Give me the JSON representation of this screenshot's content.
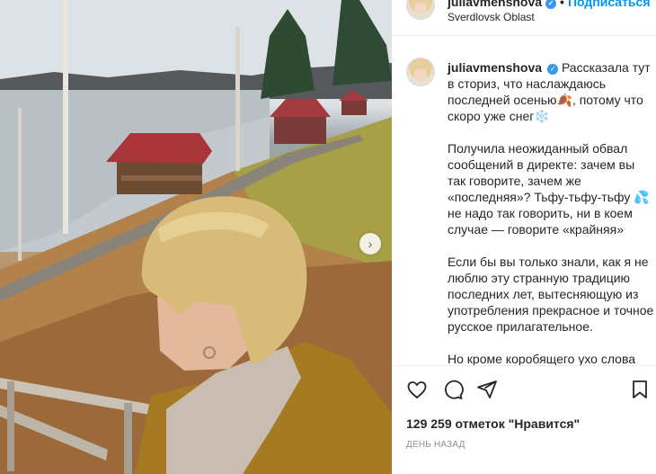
{
  "post": {
    "username": "juliavmenshova",
    "follow_label": "Подписаться",
    "separator": "•",
    "location": "Sverdlovsk Oblast"
  },
  "caption": {
    "username": "juliavmenshova",
    "paragraph_1": "Рассказала тут в сториз, что наслаждаюсь последней осенью🍂, потому что скоро уже снег❄️",
    "paragraph_2": "Получила неожиданный обвал сообщений в директе: зачем вы так говорите, зачем же «последняя»? Тьфу-тьфу-тьфу 💦 не надо так говорить, ни в коем случае — говорите «крайняя»",
    "paragraph_3": "Если бы вы только знали, как я не люблю эту странную традицию последних лет, вытесняющую из употребления прекрасное и точное русское прилагательное.",
    "paragraph_4": "Но кроме коробящего ухо слова «крайний», меня занимает и сам факт..."
  },
  "stats": {
    "likes": "129 259 отметок \"Нравится\"",
    "time_ago": "ДЕНЬ НАЗАД"
  },
  "icons": {
    "like": "heart-icon",
    "comment": "comment-icon",
    "share": "share-icon",
    "save": "bookmark-icon",
    "next": "chevron-right-icon",
    "verified": "verified-badge-icon"
  },
  "colors": {
    "link_blue": "#0095f6",
    "verified_blue": "#3897f0",
    "text": "#262626",
    "muted": "#8e8e8e"
  }
}
